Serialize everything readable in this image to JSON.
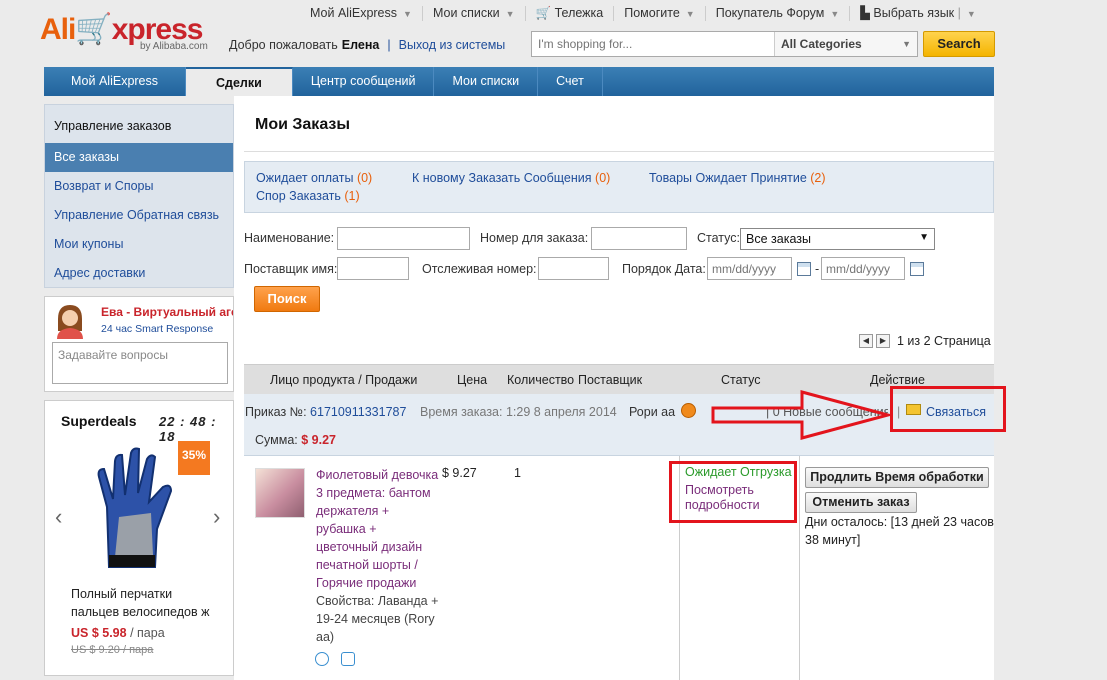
{
  "header": {
    "logo_ali": "Ali",
    "logo_express": "xpress",
    "logo_sub": "by Alibaba.com",
    "topnav": [
      {
        "label": "Мой AliExpress",
        "caret": true
      },
      {
        "label": "Мои списки",
        "caret": true
      },
      {
        "label": "Тележка",
        "caret": false
      },
      {
        "label": "Помогите",
        "caret": true
      },
      {
        "label": "Покупатель Форум",
        "caret": true
      },
      {
        "label": "Выбрать язык",
        "caret": false
      }
    ],
    "welcome": "Добро пожаловать",
    "user": "Елена",
    "logout": "Выход из системы",
    "search_placeholder": "I'm shopping for...",
    "category": "All Categories",
    "search_button": "Search"
  },
  "mainnav": [
    "Мой AliExpress",
    "Сделки",
    "Центр сообщений",
    "Мои списки",
    "Счет"
  ],
  "sidebar": {
    "heading": "Управление заказов",
    "items": [
      "Все заказы",
      "Возврат и Споры",
      "Управление Обратная связь",
      "Мои купоны",
      "Адрес доставки"
    ]
  },
  "agent": {
    "name": "Ева - Виртуальный агент",
    "sub": "24 час Smart Response",
    "ask_placeholder": "Задавайте вопросы"
  },
  "deals": {
    "title": "Superdeals",
    "timer": "22 : 48 : 18",
    "badge": "35%",
    "product": "Полный перчатки пальцев велосипедов ж",
    "price": "US $ 5.98",
    "unit": "/ пара",
    "old_price": "US $ 9.20 / пара"
  },
  "main": {
    "title": "Мои Заказы",
    "summary": [
      {
        "label": "Ожидает оплаты",
        "count": "(0)"
      },
      {
        "label": "К новому Заказать Сообщения",
        "count": "(0)"
      },
      {
        "label": "Товары Ожидает Принятие",
        "count": "(2)"
      },
      {
        "label": "Спор Заказать",
        "count": "(1)"
      }
    ],
    "filters": {
      "name_label": "Наименование:",
      "order_no_label": "Номер для заказа:",
      "status_label": "Статус:",
      "status_value": "Все заказы",
      "supplier_label": "Поставщик имя:",
      "tracking_label": "Отслеживая номер:",
      "date_label": "Порядок Дата:",
      "date_placeholder": "mm/dd/yyyy",
      "dash": "-",
      "search_button": "Поиск"
    },
    "pager": "1 из 2 Страница",
    "columns": [
      "Лицо продукта / Продажи",
      "Цена",
      "Количество",
      "Поставщик",
      "Статус",
      "Действие"
    ],
    "order": {
      "no_label": "Приказ №:",
      "no": "61710911331787",
      "time": "Время заказа: 1:29 8 апреля 2014",
      "seller": "Рори аа",
      "messages": "| 0 Новые сообщения",
      "contact": "Связаться",
      "sum_label": "Сумма:",
      "sum": "$ 9.27",
      "product": "Фиолетовый девочка 3 предмета: бантом держателя + рубашка + цветочный дизайн печатной шорты / Горячие продажи",
      "props": "Свойства: Лаванда + 19-24 месяцев (Rory aa)",
      "price": "$ 9.27",
      "qty": "1",
      "status": "Ожидает Отгрузка",
      "details": "Посмотреть подробности",
      "extend_button": "Продлить Время обработки",
      "cancel_button": "Отменить заказ",
      "days_left": "Дни осталось: [13 дней 23 часов 38 минут]"
    }
  },
  "colors": {
    "accent_orange": "#e8600c",
    "nav_blue": "#21639c",
    "annotation_red": "#e3141c"
  }
}
